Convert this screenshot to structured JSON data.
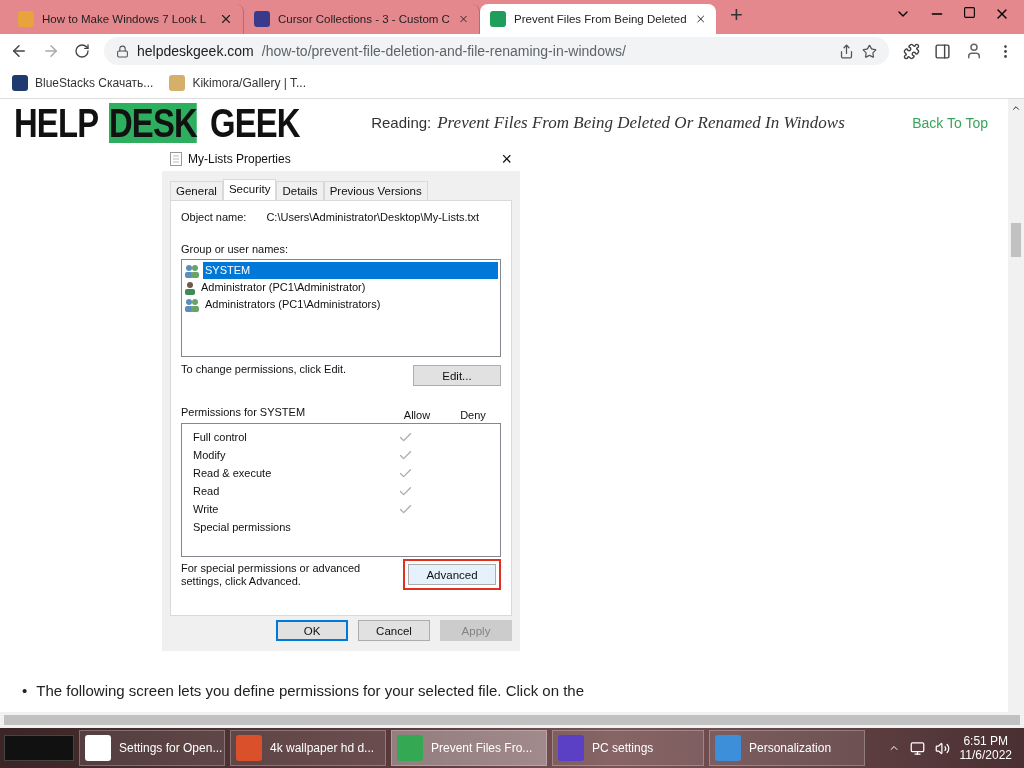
{
  "browser": {
    "tabs": [
      {
        "title": "How to Make Windows 7 Look L",
        "selected": false,
        "color": "#e8a33c"
      },
      {
        "title": "Cursor Collections - 3 - Custom C",
        "selected": false,
        "color": "#3a3a8c"
      },
      {
        "title": "Prevent Files From Being Deleted",
        "selected": true,
        "color": "#1e9e5a"
      }
    ],
    "new_tab": "+",
    "address": {
      "domain": "helpdeskgeek.com",
      "path": "/how-to/prevent-file-deletion-and-file-renaming-in-windows/"
    },
    "bookmarks": [
      {
        "label": "BlueStacks Скачать...",
        "color": "#1f3a6e"
      },
      {
        "label": "Kikimora/Gallery | T...",
        "color": "#d4b06a"
      }
    ]
  },
  "page": {
    "logo": [
      {
        "text": "HELP",
        "highlighted": false
      },
      {
        "text": "DESK",
        "highlighted": true
      },
      {
        "text": "GEEK",
        "highlighted": false
      }
    ],
    "reading_label": "Reading:",
    "reading_title": "Prevent Files From Being Deleted Or Renamed In Windows",
    "back_to_top": "Back To Top",
    "dialog": {
      "title": "My-Lists Properties",
      "close": "×",
      "tabs": [
        {
          "label": "General",
          "selected": false
        },
        {
          "label": "Security",
          "selected": true
        },
        {
          "label": "Details",
          "selected": false
        },
        {
          "label": "Previous Versions",
          "selected": false
        }
      ],
      "object_name_label": "Object name:",
      "object_name": "C:\\Users\\Administrator\\Desktop\\My-Lists.txt",
      "group_label": "Group or user names:",
      "users": [
        {
          "name": "SYSTEM",
          "selected": true,
          "kind": "group"
        },
        {
          "name": "Administrator (PC1\\Administrator)",
          "selected": false,
          "kind": "user"
        },
        {
          "name": "Administrators (PC1\\Administrators)",
          "selected": false,
          "kind": "group"
        }
      ],
      "change_hint": "To change permissions, click Edit.",
      "edit_button": "Edit...",
      "permissions_label": "Permissions for SYSTEM",
      "allow_header": "Allow",
      "deny_header": "Deny",
      "permissions": [
        {
          "name": "Full control",
          "allow": true,
          "deny": false
        },
        {
          "name": "Modify",
          "allow": true,
          "deny": false
        },
        {
          "name": "Read & execute",
          "allow": true,
          "deny": false
        },
        {
          "name": "Read",
          "allow": true,
          "deny": false
        },
        {
          "name": "Write",
          "allow": true,
          "deny": false
        },
        {
          "name": "Special permissions",
          "allow": false,
          "deny": false
        }
      ],
      "advanced_hint": "For special permissions or advanced settings, click Advanced.",
      "advanced_button": {
        "label": "Advanced",
        "highlighted": true
      },
      "buttons": [
        {
          "label": "OK",
          "kind": "default"
        },
        {
          "label": "Cancel",
          "kind": "normal"
        },
        {
          "label": "Apply",
          "kind": "disabled"
        }
      ]
    },
    "bullets": [
      {
        "marker": "•",
        "text": "The following screen lets you define permissions for your selected file. Click on the"
      }
    ]
  },
  "taskbar": {
    "items": [
      {
        "label": "Settings for Open...",
        "selected": false,
        "color": "#ffffff"
      },
      {
        "label": "4k wallpaper hd d...",
        "selected": false,
        "color": "#d9502a"
      },
      {
        "label": "Prevent Files Fro...",
        "selected": true,
        "color": "#34a853"
      },
      {
        "label": "PC settings",
        "selected": false,
        "color": "#5b3fc4"
      },
      {
        "label": "Personalization",
        "selected": false,
        "color": "#3c8fd8"
      }
    ],
    "time": "6:51 PM",
    "date": "11/6/2022"
  }
}
